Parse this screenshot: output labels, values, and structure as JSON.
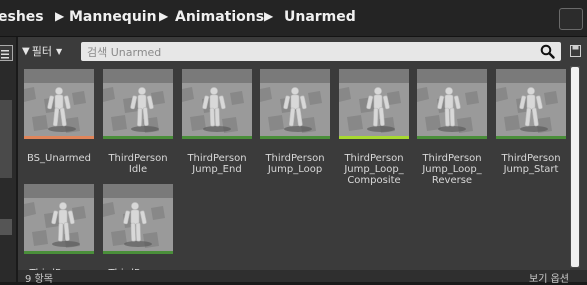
{
  "breadcrumb": [
    "eshes",
    "Mannequin",
    "Animations",
    "Unarmed"
  ],
  "filter": {
    "label": "필터"
  },
  "search": {
    "placeholder": "검색 Unarmed"
  },
  "assets": [
    {
      "name": "BS_Unarmed",
      "accent": "#e0855a"
    },
    {
      "name": "ThirdPerson Idle",
      "accent": "#4a8f3a"
    },
    {
      "name": "ThirdPerson Jump_End",
      "accent": "#4a8f3a"
    },
    {
      "name": "ThirdPerson Jump_Loop",
      "accent": "#4a8f3a"
    },
    {
      "name": "ThirdPerson Jump_Loop_ Composite",
      "accent": "#a7d930"
    },
    {
      "name": "ThirdPerson Jump_Loop_ Reverse",
      "accent": "#4a8f3a"
    },
    {
      "name": "ThirdPerson Jump_Start",
      "accent": "#4a8f3a"
    },
    {
      "name": "ThirdPerson",
      "accent": "#4a8f3a"
    },
    {
      "name": "ThirdPerson",
      "accent": "#4a8f3a"
    }
  ],
  "status": {
    "count": "9 항목",
    "view": "보기 옵션"
  }
}
